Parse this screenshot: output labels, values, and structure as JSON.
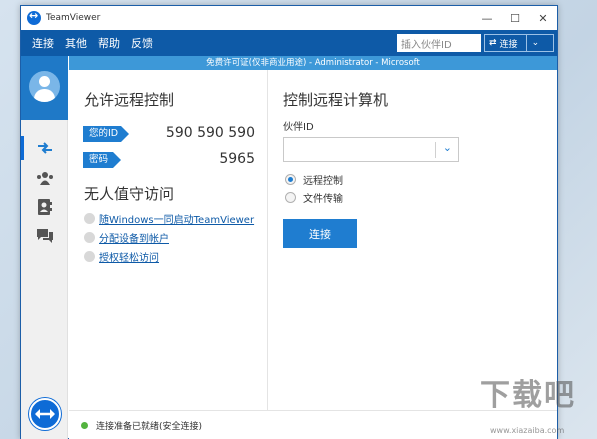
{
  "window": {
    "title": "TeamViewer"
  },
  "titlebar": {
    "minimize": "—",
    "maximize": "☐",
    "close": "✕"
  },
  "menu": {
    "items": [
      "连接",
      "其他",
      "帮助",
      "反馈"
    ]
  },
  "toolbar": {
    "partner_placeholder": "插入伙伴ID",
    "connect_label": "连接",
    "connect_arrow": "⇄",
    "dropdown_chevron": "⌄"
  },
  "banner": {
    "text": "免费许可证(仅非商业用途) - Administrator - Microsoft"
  },
  "sidebar": {
    "icons": [
      "remote-control-icon",
      "meeting-icon",
      "contacts-icon",
      "chat-icon"
    ]
  },
  "allow": {
    "heading": "允许远程控制",
    "id_label": "您的ID",
    "id_value": "590 590 590",
    "password_label": "密码",
    "password_value": "5965"
  },
  "unattended": {
    "heading": "无人值守访问",
    "links": [
      "随Windows一同启动TeamViewer",
      "分配设备到帐户",
      "授权轻松访问"
    ]
  },
  "control": {
    "heading": "控制远程计算机",
    "partner_id_label": "伙伴ID",
    "partner_id_value": "",
    "combo_chevron": "⌄",
    "options": [
      {
        "label": "远程控制",
        "selected": true
      },
      {
        "label": "文件传输",
        "selected": false
      }
    ],
    "connect_button": "连接"
  },
  "status": {
    "text": "连接准备已就绪(安全连接)",
    "color": "#53b33f"
  },
  "watermark": {
    "text": "下载吧",
    "url": "www.xiazaiba.com"
  },
  "colors": {
    "brand": "#0e5aa7",
    "accent": "#1f7dd0",
    "banner": "#3d98d8"
  }
}
